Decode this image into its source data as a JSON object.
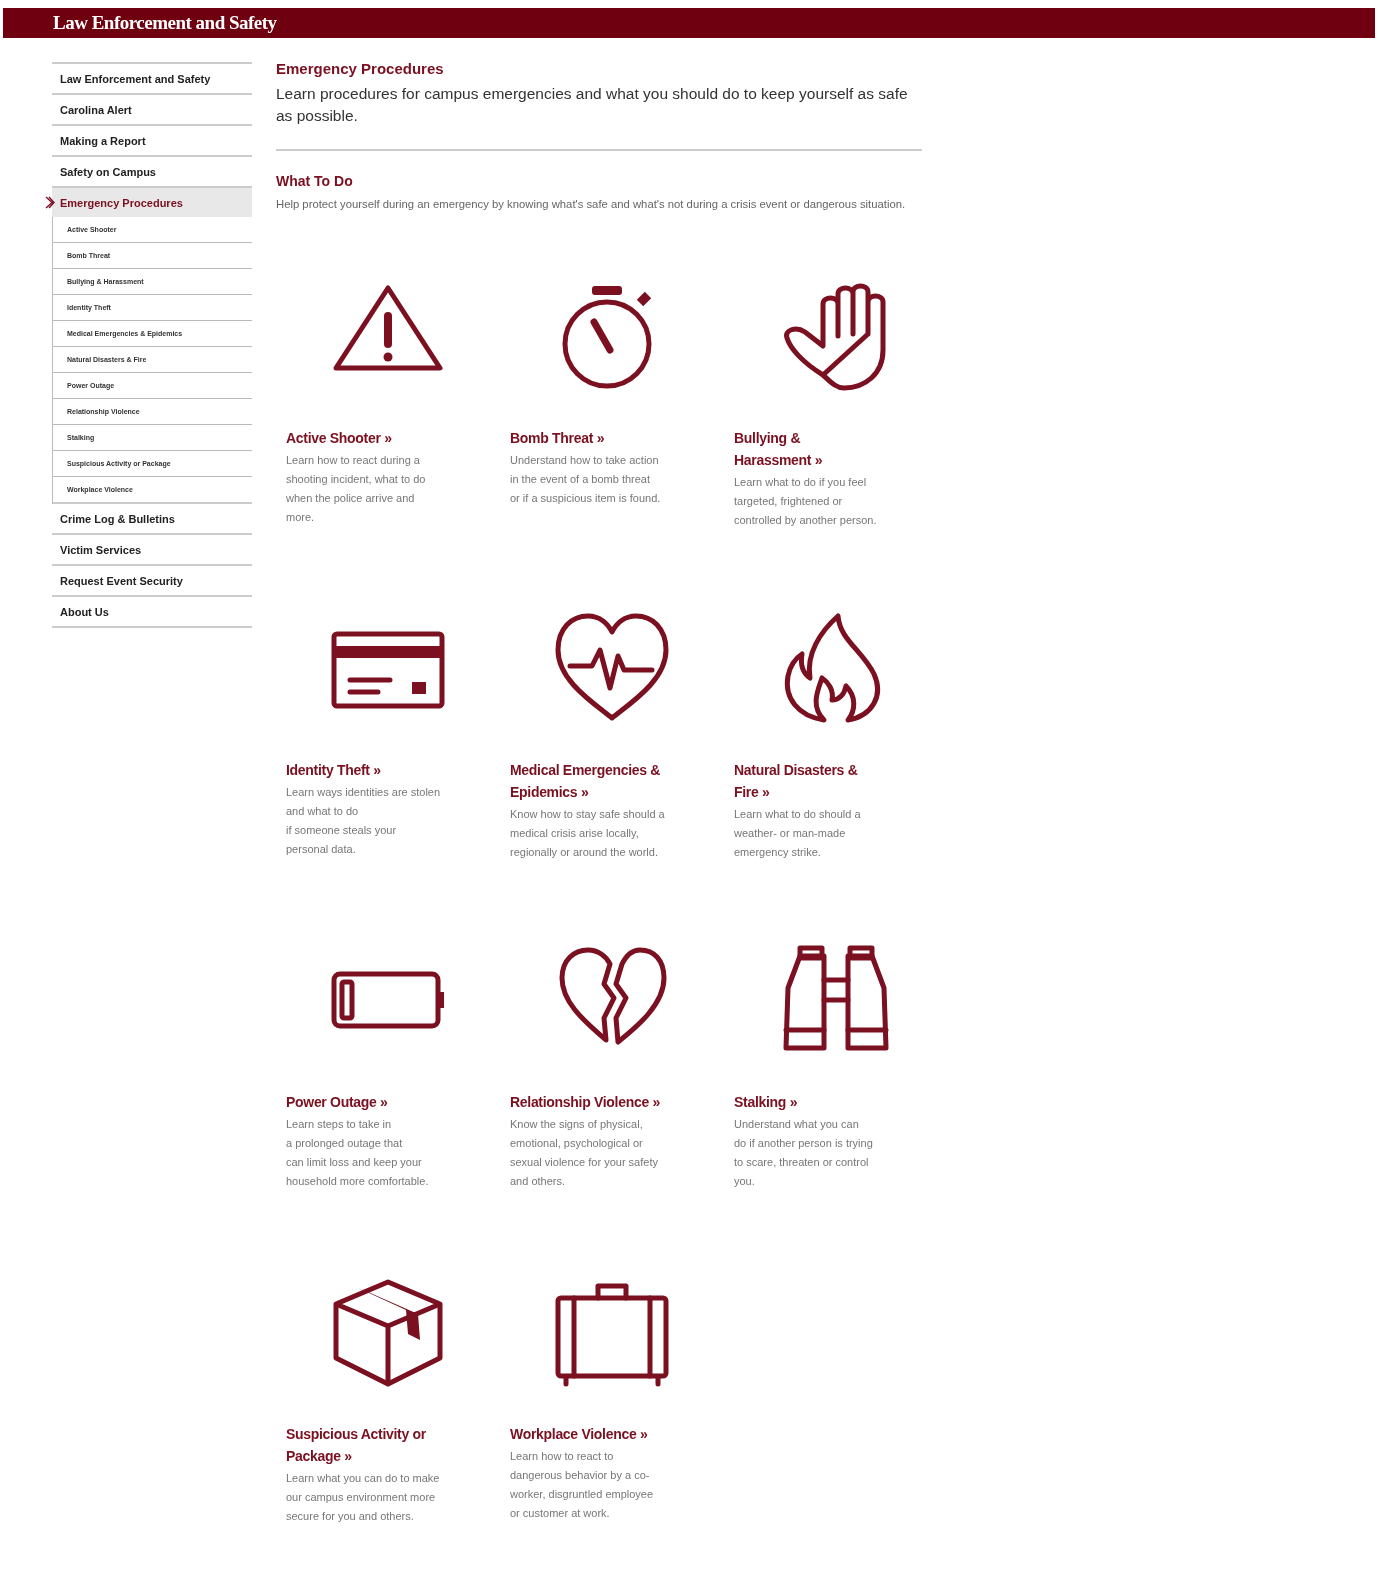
{
  "header": {
    "title": "Law Enforcement and Safety"
  },
  "sidebar": {
    "items": [
      {
        "label": "Law Enforcement and Safety",
        "selected": false
      },
      {
        "label": "Carolina Alert",
        "selected": false
      },
      {
        "label": "Making a Report",
        "selected": false
      },
      {
        "label": "Safety on Campus",
        "selected": false
      },
      {
        "label": "Emergency Procedures",
        "selected": true,
        "children": [
          {
            "label": "Active Shooter",
            "selected": false
          },
          {
            "label": "Bomb Threat",
            "selected": false
          },
          {
            "label": "Bullying & Harassment",
            "selected": false
          },
          {
            "label": "Identity Theft",
            "selected": false
          },
          {
            "label": "Medical Emergencies & Epidemics",
            "selected": false
          },
          {
            "label": "Natural Disasters & Fire",
            "selected": false
          },
          {
            "label": "Power Outage",
            "selected": false
          },
          {
            "label": "Relationship Violence",
            "selected": false
          },
          {
            "label": "Stalking",
            "selected": false
          },
          {
            "label": "Suspicious Activity or Package",
            "selected": false
          },
          {
            "label": "Workplace Violence",
            "selected": false
          }
        ]
      },
      {
        "label": "Crime Log & Bulletins",
        "selected": false
      },
      {
        "label": "Victim Services",
        "selected": false
      },
      {
        "label": "Request Event Security",
        "selected": false
      },
      {
        "label": "About Us",
        "selected": false
      }
    ]
  },
  "main": {
    "title": "Emergency Procedures",
    "intro": "Learn procedures for campus emergencies and what you should do to keep yourself as safe as possible.",
    "section": {
      "title": "What To Do",
      "text": "Help protect yourself during an emergency by knowing what's safe and what's not during a crisis event or dangerous situation."
    },
    "cards": [
      {
        "title": "Active Shooter »",
        "text": "Learn how to react during a\nshooting incident, what to do\nwhen the police arrive and\nmore."
      },
      {
        "title": "Bomb Threat »",
        "text": "Understand how to take action\nin the event of a bomb threat\nor if a suspicious item is found."
      },
      {
        "title": "Bullying &\nHarassment »",
        "text": "Learn what to do if you feel\ntargeted, frightened or\ncontrolled by another person."
      },
      {
        "title": "Identity Theft »",
        "text": "Learn ways identities are stolen\nand what to do\nif someone steals your\npersonal data."
      },
      {
        "title": "Medical Emergencies &\nEpidemics »",
        "text": "Know how to stay safe should a\nmedical crisis arise locally,\nregionally or around the world."
      },
      {
        "title": "Natural Disasters &\nFire »",
        "text": "Learn what to do should a\nweather- or man-made\nemergency strike."
      },
      {
        "title": "Power Outage »",
        "text": "Learn steps to take in\na prolonged outage that\ncan limit loss and keep your\nhousehold more comfortable."
      },
      {
        "title": "Relationship Violence »",
        "text": "Know the signs of physical,\nemotional, psychological or\nsexual violence for your safety\nand others."
      },
      {
        "title": "Stalking »",
        "text": "Understand what you can\ndo if another person is trying\nto scare, threaten or control\nyou."
      },
      {
        "title": "Suspicious Activity or\nPackage »",
        "text": "Learn what you can do to make\nour campus environment more\nsecure for you and others."
      },
      {
        "title": "Workplace Violence »",
        "text": "Learn how to react to\ndangerous behavior by a co-\nworker, disgruntled employee\nor customer at work."
      }
    ]
  }
}
